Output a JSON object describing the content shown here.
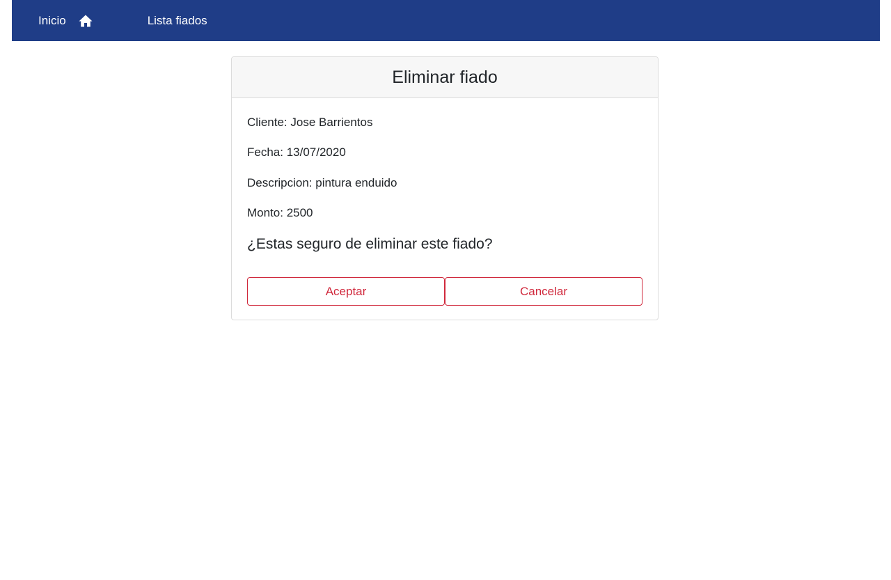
{
  "nav": {
    "home_label": "Inicio",
    "home_icon": "home-icon",
    "list_label": "Lista fiados",
    "background": "#1f3d87"
  },
  "card": {
    "title": "Eliminar fiado",
    "cliente": "Cliente: Jose Barrientos",
    "fecha": "Fecha: 13/07/2020",
    "descripcion": "Descripcion: pintura enduido",
    "monto": "Monto: 2500",
    "question": "¿Estas seguro de eliminar este fiado?",
    "accept_label": "Aceptar",
    "cancel_label": "Cancelar",
    "button_color": "#d0283c"
  }
}
